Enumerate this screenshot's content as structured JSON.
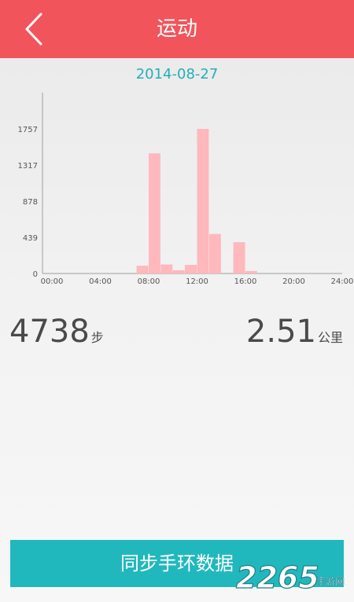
{
  "header": {
    "title": "运动",
    "back_icon": "chevron-left-icon"
  },
  "date": "2014-08-27",
  "chart_data": {
    "type": "bar",
    "x": [
      "00:00",
      "04:00",
      "08:00",
      "12:00",
      "16:00",
      "20:00",
      "24:00"
    ],
    "y_ticks": [
      0,
      439,
      878,
      1317,
      1757
    ],
    "ylim": [
      0,
      1757
    ],
    "bars": [
      {
        "hour": 7.0,
        "value": 95
      },
      {
        "hour": 8.0,
        "value": 1460
      },
      {
        "hour": 9.0,
        "value": 110
      },
      {
        "hour": 10.0,
        "value": 40
      },
      {
        "hour": 11.0,
        "value": 105
      },
      {
        "hour": 12.0,
        "value": 1757
      },
      {
        "hour": 13.0,
        "value": 480
      },
      {
        "hour": 15.0,
        "value": 380
      },
      {
        "hour": 16.0,
        "value": 30
      }
    ],
    "bar_color": "#ffb8bc",
    "axis_color": "#9e9e9e"
  },
  "stats": {
    "steps_value": "4738",
    "steps_unit": "步",
    "distance_value": "2.51",
    "distance_unit": "公里"
  },
  "sync_button": {
    "label": "同步手环数据"
  },
  "watermark": {
    "text": "2265",
    "subtext": "手游网"
  },
  "colors": {
    "header": "#f2545b",
    "accent": "#25aeb8",
    "button": "#21b8bd"
  }
}
